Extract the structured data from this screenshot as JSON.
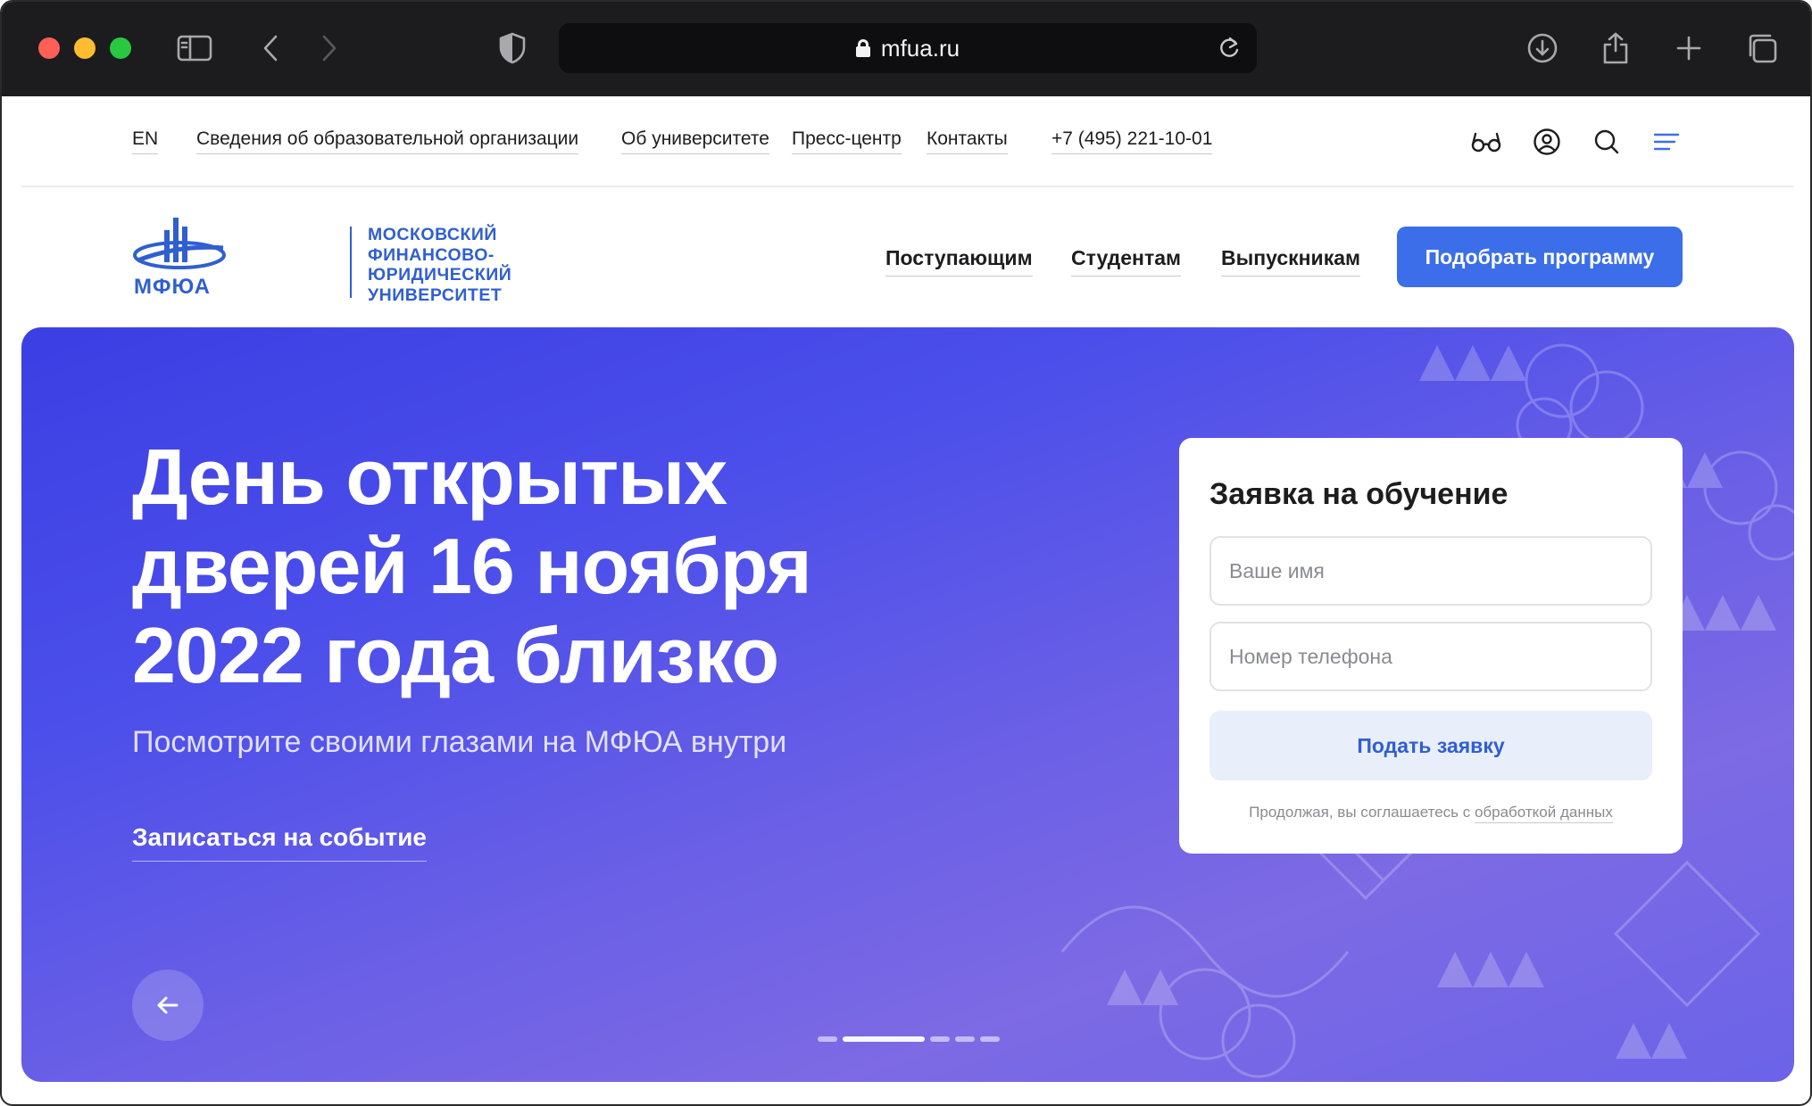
{
  "browser": {
    "url": "mfua.ru"
  },
  "utility_nav": {
    "lang": "EN",
    "links": [
      "Сведения об образовательной организации",
      "Об университете",
      "Пресс-центр",
      "Контакты"
    ],
    "phone": "+7 (495) 221-10-01"
  },
  "logo": {
    "lines": [
      "МОСКОВСКИЙ",
      "ФИНАНСОВО-",
      "ЮРИДИЧЕСКИЙ",
      "УНИВЕРСИТЕТ"
    ],
    "abbr": "МФЮА"
  },
  "main_nav": {
    "items": [
      "Поступающим",
      "Студентам",
      "Выпускникам"
    ],
    "cta": "Подобрать программу"
  },
  "hero": {
    "title_lines": [
      "День открытых",
      "дверей 16 ноября",
      "2022 года близко"
    ],
    "subtitle": "Посмотрите своими глазами на МФЮА внутри",
    "link": "Записаться на событие",
    "slides_total": 5,
    "slide_active": 2
  },
  "form": {
    "title": "Заявка на обучение",
    "name_placeholder": "Ваше имя",
    "phone_placeholder": "Номер телефона",
    "submit": "Подать заявку",
    "consent_text": "Продолжая, вы соглашаетесь с ",
    "consent_link": "обработкой данных"
  },
  "colors": {
    "accent": "#3b6ee8",
    "brand_text": "#2f5fd0",
    "hero_start": "#3b3fe3",
    "hero_end": "#7d6ae4"
  }
}
